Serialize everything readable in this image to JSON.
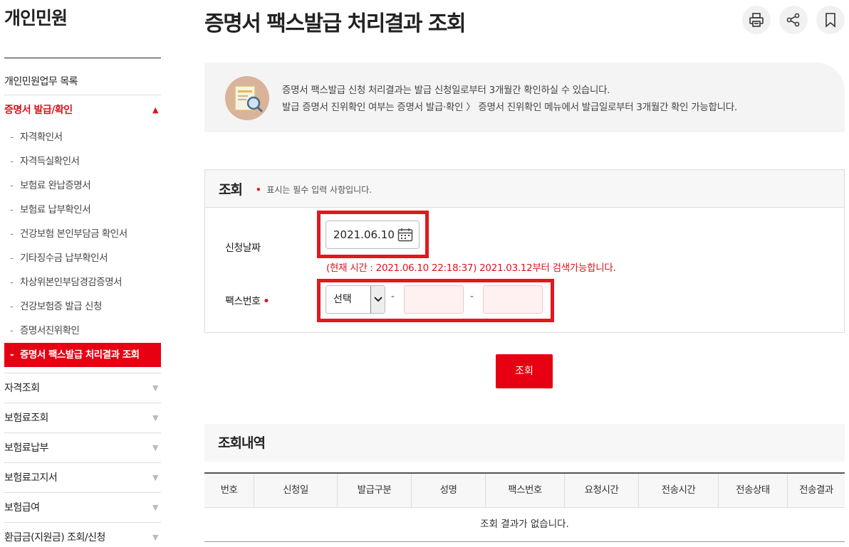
{
  "sidebar": {
    "title": "개인민원",
    "list_link": "개인민원업무 목록",
    "active_menu": "증명서 발급/확인",
    "sub_items": [
      "자격확인서",
      "자격득실확인서",
      "보험료 완납증명서",
      "보험료 납부확인서",
      "건강보험 본인부담금 확인서",
      "기타징수금 납부확인서",
      "차상위본인부담경감증명서",
      "건강보험증 발급 신청",
      "증명서진위확인",
      "증명서 팩스발급 처리결과 조회"
    ],
    "menus": [
      "자격조회",
      "보험료조회",
      "보험료납부",
      "보험료고지서",
      "보험급여",
      "환급금(지원금) 조회/신청"
    ]
  },
  "header": {
    "title": "증명서 팩스발급 처리결과 조회",
    "tools": [
      "print-icon",
      "share-icon",
      "bookmark-icon"
    ]
  },
  "info": {
    "line1": "증명서 팩스발급 신청 처리결과는 발급 신청일로부터 3개월간 확인하실 수 있습니다.",
    "line2": "발급 증명서 진위확인 여부는 증명서 발급·확인 〉 증명서 진위확인 메뉴에서 발급일로부터 3개월간 확인 가능합니다."
  },
  "search": {
    "heading": "조회",
    "required_note": "표시는 필수 입력 사항입니다.",
    "date_label": "신청날짜",
    "date_value": "2021.06.10",
    "notice": "(현재 시간 : 2021.06.10 22:18:37) 2021.03.12부터 검색가능합니다.",
    "fax_label": "팩스번호",
    "fax_select": "선택",
    "hyphen": "-",
    "button": "조회"
  },
  "results": {
    "heading": "조회내역",
    "columns": [
      "번호",
      "신청일",
      "발급구분",
      "성명",
      "팩스번호",
      "요청시간",
      "전송시간",
      "전송상태",
      "전송결과"
    ],
    "empty": "조회 결과가 없습니다."
  },
  "colors": {
    "accent": "#e60012",
    "highlight_frame": "#e0181f"
  }
}
